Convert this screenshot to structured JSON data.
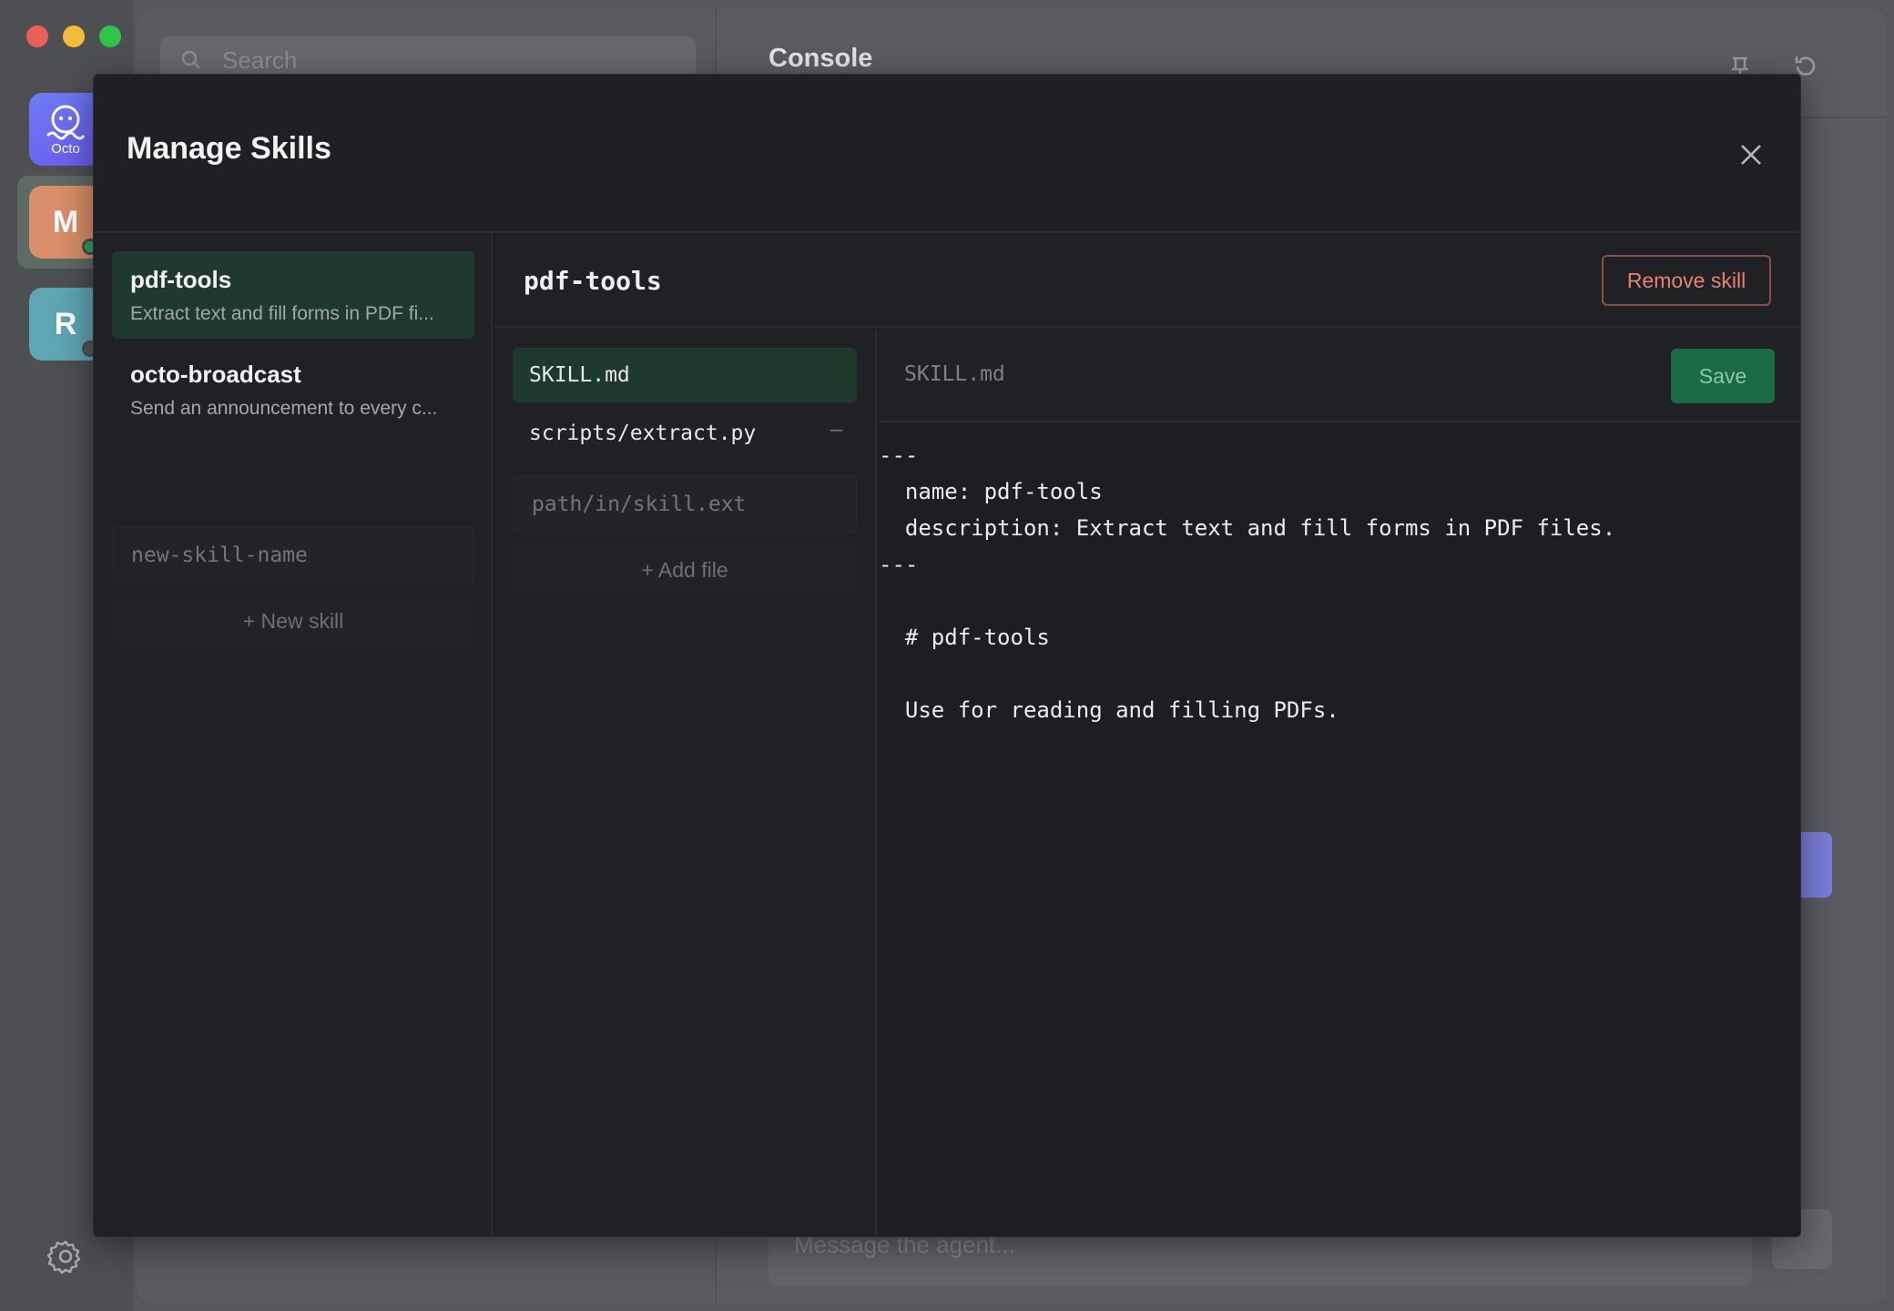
{
  "background": {
    "search_placeholder": "Search",
    "header_title": "Console",
    "workspaces": [
      {
        "label": "Octo"
      },
      {
        "initial": "M"
      },
      {
        "initial": "R"
      }
    ],
    "message_placeholder": "Message the agent..."
  },
  "modal": {
    "title": "Manage Skills",
    "skills": [
      {
        "name": "pdf-tools",
        "description": "Extract text and fill forms in PDF fi..."
      },
      {
        "name": "octo-broadcast",
        "description": "Send an announcement to every c..."
      }
    ],
    "new_skill_placeholder": "new-skill-name",
    "new_skill_button": "+ New skill",
    "detail": {
      "title": "pdf-tools",
      "remove_button": "Remove skill",
      "files": [
        {
          "path": "SKILL.md"
        },
        {
          "path": "scripts/extract.py",
          "remove": "–"
        }
      ],
      "path_placeholder": "path/in/skill.ext",
      "add_file_button": "+ Add file",
      "editor": {
        "filename": "SKILL.md",
        "save_button": "Save",
        "content": "---\n  name: pdf-tools\n  description: Extract text and fill forms in PDF files.\n---\n\n  # pdf-tools\n\n  Use for reading and filling PDFs."
      }
    }
  },
  "colors": {
    "active_item": "#1e3a2f",
    "save_green": "#1a6a44",
    "remove_red": "#e8826f",
    "modal_bg": "#1f2024"
  }
}
